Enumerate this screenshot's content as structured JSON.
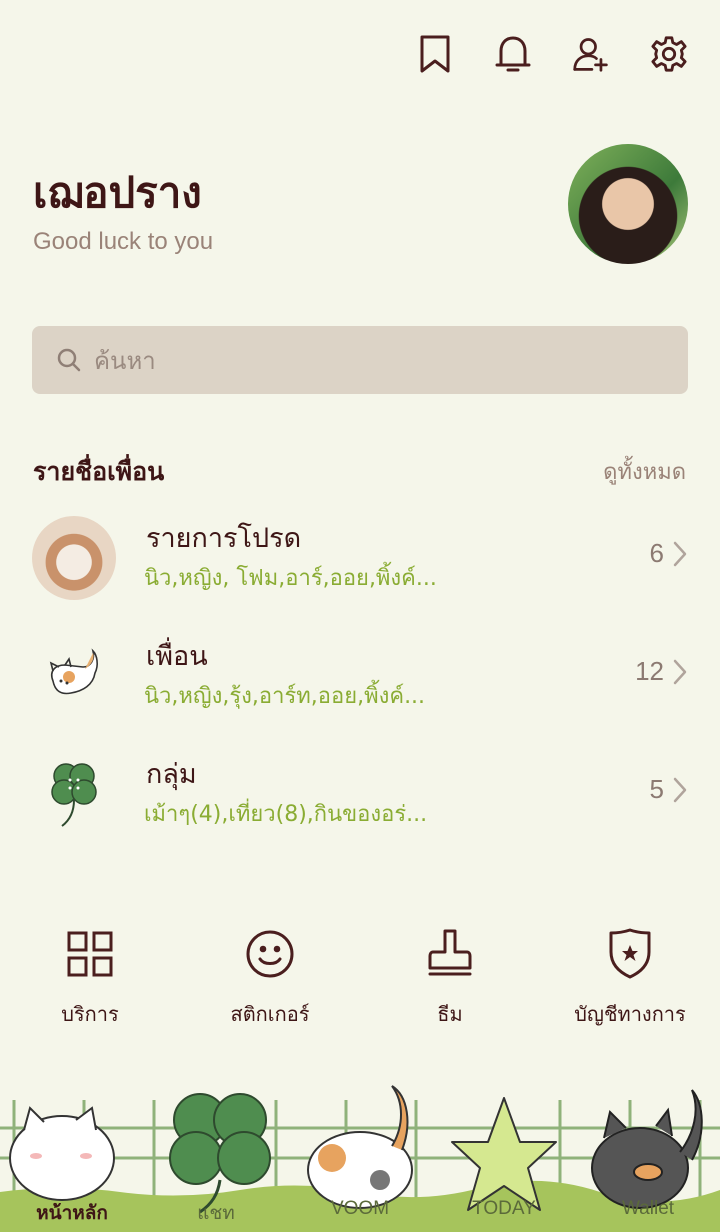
{
  "header": {
    "icons": [
      "bookmark-icon",
      "bell-icon",
      "add-friend-icon",
      "gear-icon"
    ]
  },
  "profile": {
    "name": "เฌอปราง",
    "status": "Good luck to you"
  },
  "search": {
    "placeholder": "ค้นหา"
  },
  "friends_section": {
    "title": "รายชื่อเพื่อน",
    "see_all": "ดูทั้งหมด",
    "rows": [
      {
        "title": "รายการโปรด",
        "sub": "นิว,หญิง, โฟม,อาร์,ออย,พิ้งค์...",
        "count": "6"
      },
      {
        "title": "เพื่อน",
        "sub": "นิว,หญิง,รุ้ง,อาร์ท,ออย,พิ้งค์...",
        "count": "12"
      },
      {
        "title": "กลุ่ม",
        "sub": "เม้าๆ(4),เที่ยว(8),กินของอร่...",
        "count": "5"
      }
    ]
  },
  "shortcuts": [
    {
      "label": "บริการ",
      "icon": "grid-icon"
    },
    {
      "label": "สติกเกอร์",
      "icon": "smiley-icon"
    },
    {
      "label": "ธีม",
      "icon": "brush-icon"
    },
    {
      "label": "บัญชีทางการ",
      "icon": "shield-star-icon"
    }
  ],
  "tabs": [
    {
      "label": "หน้าหลัก",
      "active": true
    },
    {
      "label": "แชท"
    },
    {
      "label": "VOOM"
    },
    {
      "label": "TODAY"
    },
    {
      "label": "Wallet"
    }
  ],
  "colors": {
    "background": "#f5f6ea",
    "text": "#4a1e1e",
    "accent_green": "#8aac33",
    "search_bg": "#dcd3c6"
  }
}
